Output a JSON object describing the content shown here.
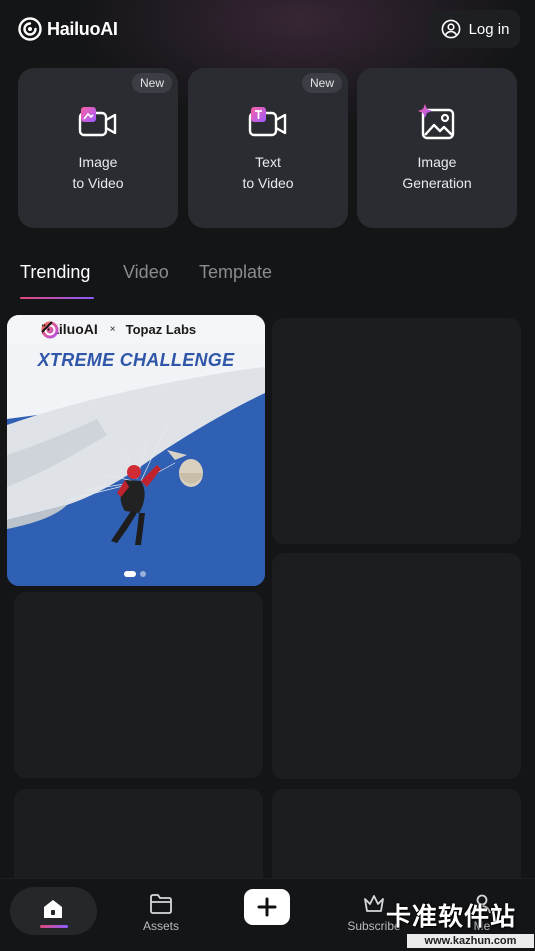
{
  "header": {
    "brand": "HailuoAI",
    "login_label": "Log in"
  },
  "tools": [
    {
      "line1": "Image",
      "line2": "to Video",
      "badge": "New",
      "icon": "image-to-video-icon"
    },
    {
      "line1": "Text",
      "line2": "to Video",
      "badge": "New",
      "icon": "text-to-video-icon"
    },
    {
      "line1": "Image",
      "line2": "Generation",
      "badge": "",
      "icon": "image-generation-icon"
    }
  ],
  "tabs": [
    {
      "label": "Trending",
      "active": true
    },
    {
      "label": "Video",
      "active": false
    },
    {
      "label": "Template",
      "active": false
    }
  ],
  "featured": {
    "brand": "HailuoAI",
    "separator": "×",
    "partner": "Topaz Labs",
    "title": "XTREME CHALLENGE",
    "slide_count": 2,
    "active_slide": 1
  },
  "bottom_nav": {
    "assets": "Assets",
    "subscribe": "Subscribe",
    "me": "Me"
  },
  "watermark": {
    "text": "卡准软件站",
    "url": "www.kazhun.com"
  },
  "colors": {
    "background": "#141517",
    "card": "#2a2c31",
    "accent_start": "#e3487a",
    "accent_end": "#8a5cff"
  }
}
